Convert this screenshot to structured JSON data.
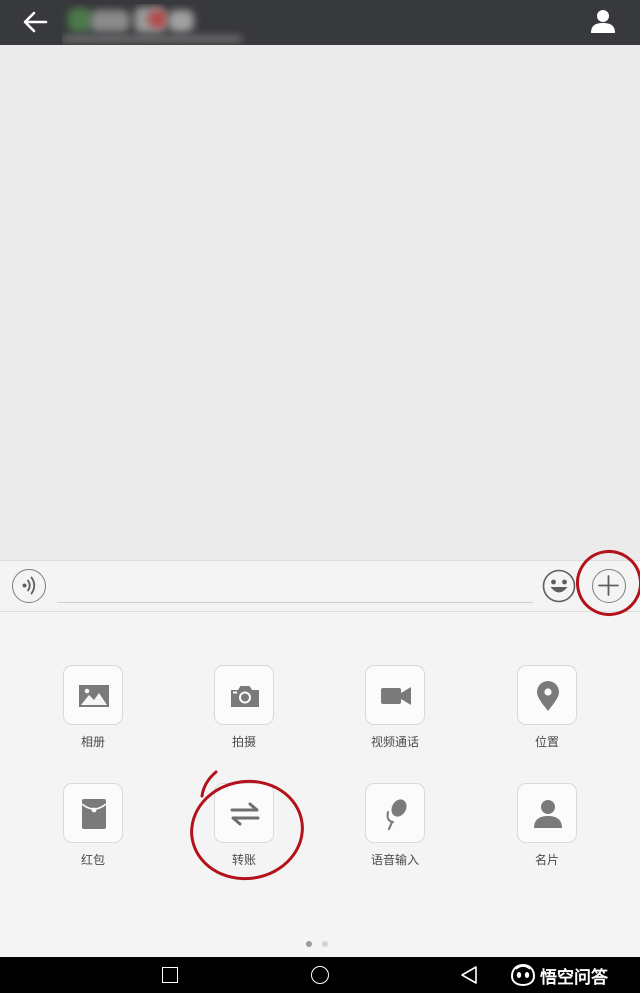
{
  "header": {
    "contact_name": "",
    "back_icon": "arrow-left-icon",
    "profile_icon": "person-icon"
  },
  "input_bar": {
    "voice_icon": "voice-wave-icon",
    "message_value": "",
    "emoji_icon": "smiley-icon",
    "more_icon": "plus-icon"
  },
  "panel": {
    "items": [
      {
        "label": "相册",
        "icon": "image-icon"
      },
      {
        "label": "拍摄",
        "icon": "camera-icon"
      },
      {
        "label": "视频通话",
        "icon": "video-camera-icon"
      },
      {
        "label": "位置",
        "icon": "location-pin-icon"
      },
      {
        "label": "红包",
        "icon": "red-packet-icon"
      },
      {
        "label": "转账",
        "icon": "transfer-arrows-icon"
      },
      {
        "label": "语音输入",
        "icon": "microphone-icon"
      },
      {
        "label": "名片",
        "icon": "contact-card-icon"
      }
    ],
    "page_count": 2,
    "current_page": 1
  },
  "navbar": {
    "watermark_text": "悟空问答"
  },
  "colors": {
    "header_bg": "#38393d",
    "chat_bg": "#ebebeb",
    "panel_bg": "#f4f4f4",
    "icon_gray": "#7e7e7e",
    "annotation_red": "#b3121b",
    "dot_active": "#9b9b9b",
    "dot_inactive": "#d6d6d6"
  }
}
